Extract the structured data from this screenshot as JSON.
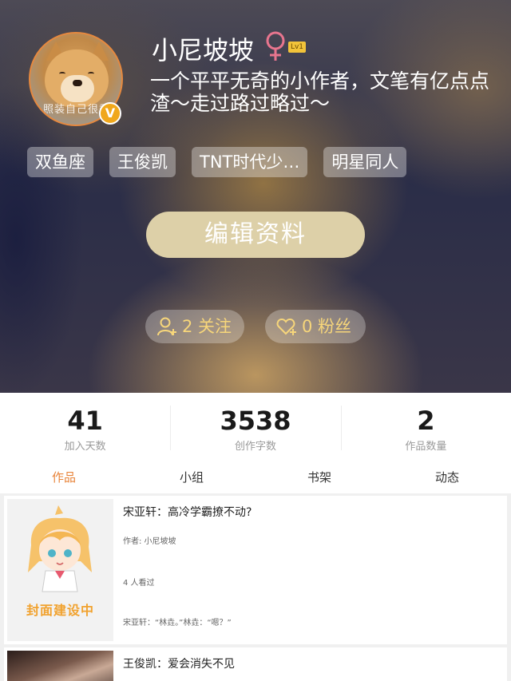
{
  "profile": {
    "username": "小尼坡坡",
    "level": "Lv1",
    "avatar_caption": "照装自己很乖",
    "verified_mark": "V",
    "bio": "一个平平无奇的小作者，文笔有亿点点渣～走过路过略过～",
    "tags": [
      "双鱼座",
      "王俊凯",
      "TNT时代少…",
      "明星同人"
    ],
    "edit_label": "编辑资料",
    "follow_label": "2 关注",
    "fans_label": "0 粉丝"
  },
  "stats": [
    {
      "value": "41",
      "label": "加入天数"
    },
    {
      "value": "3538",
      "label": "创作字数"
    },
    {
      "value": "2",
      "label": "作品数量"
    }
  ],
  "tabs": [
    "作品",
    "小组",
    "书架",
    "动态"
  ],
  "works": [
    {
      "title": "宋亚轩：高冷学霸撩不动?",
      "author": "作者: 小尼坡坡",
      "views": "4 人看过",
      "summary": "宋亚轩：“林垚。”林垚：“嗯？”",
      "cover_caption": "封面建设中"
    },
    {
      "title": "王俊凯：爱会消失不见"
    }
  ],
  "colors": {
    "accent": "#e8843a",
    "edit_button": "#ddd0a8",
    "pill_text": "#f7d67a",
    "gender_icon": "#e8758e"
  }
}
